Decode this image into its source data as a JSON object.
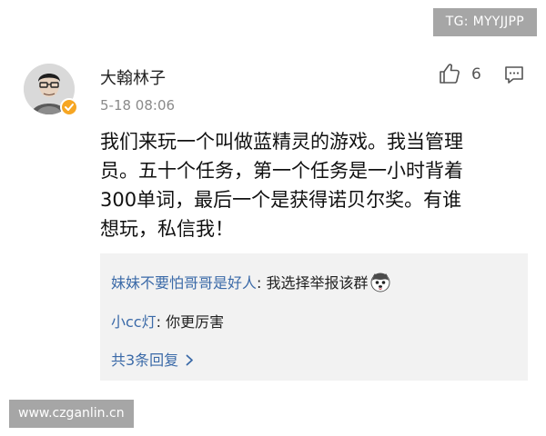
{
  "watermark_top": "TG: MYYJJPP",
  "watermark_bottom": "www.czganlin.cn",
  "post": {
    "username": "大翰林子",
    "timestamp": "5-18 08:06",
    "like_count": "6",
    "body": "我们来玩一个叫做蓝精灵的游戏。我当管理\n员。五十个任务，第一个任务是一小时背着\n300单词，最后一个是获得诺贝尔奖。有谁\n想玩，私信我！"
  },
  "replies": [
    {
      "name": "妹妹不要怕哥哥是好人",
      "sep": ": ",
      "text": "我选择举报该群",
      "emoji": "husky-emoji"
    },
    {
      "name": "小cc灯",
      "sep": ": ",
      "text": "你更厉害"
    }
  ],
  "more_replies": "共3条回复",
  "icons": {
    "like": "thumbs-up-icon",
    "comment": "comment-icon",
    "verified": "verified-badge-icon",
    "more": "chevron-right-icon"
  },
  "colors": {
    "link_blue": "#3b6aa8",
    "verified_orange": "#f6a623",
    "reply_bg": "#f2f2f2",
    "watermark_gray": "#a6a6a6"
  }
}
